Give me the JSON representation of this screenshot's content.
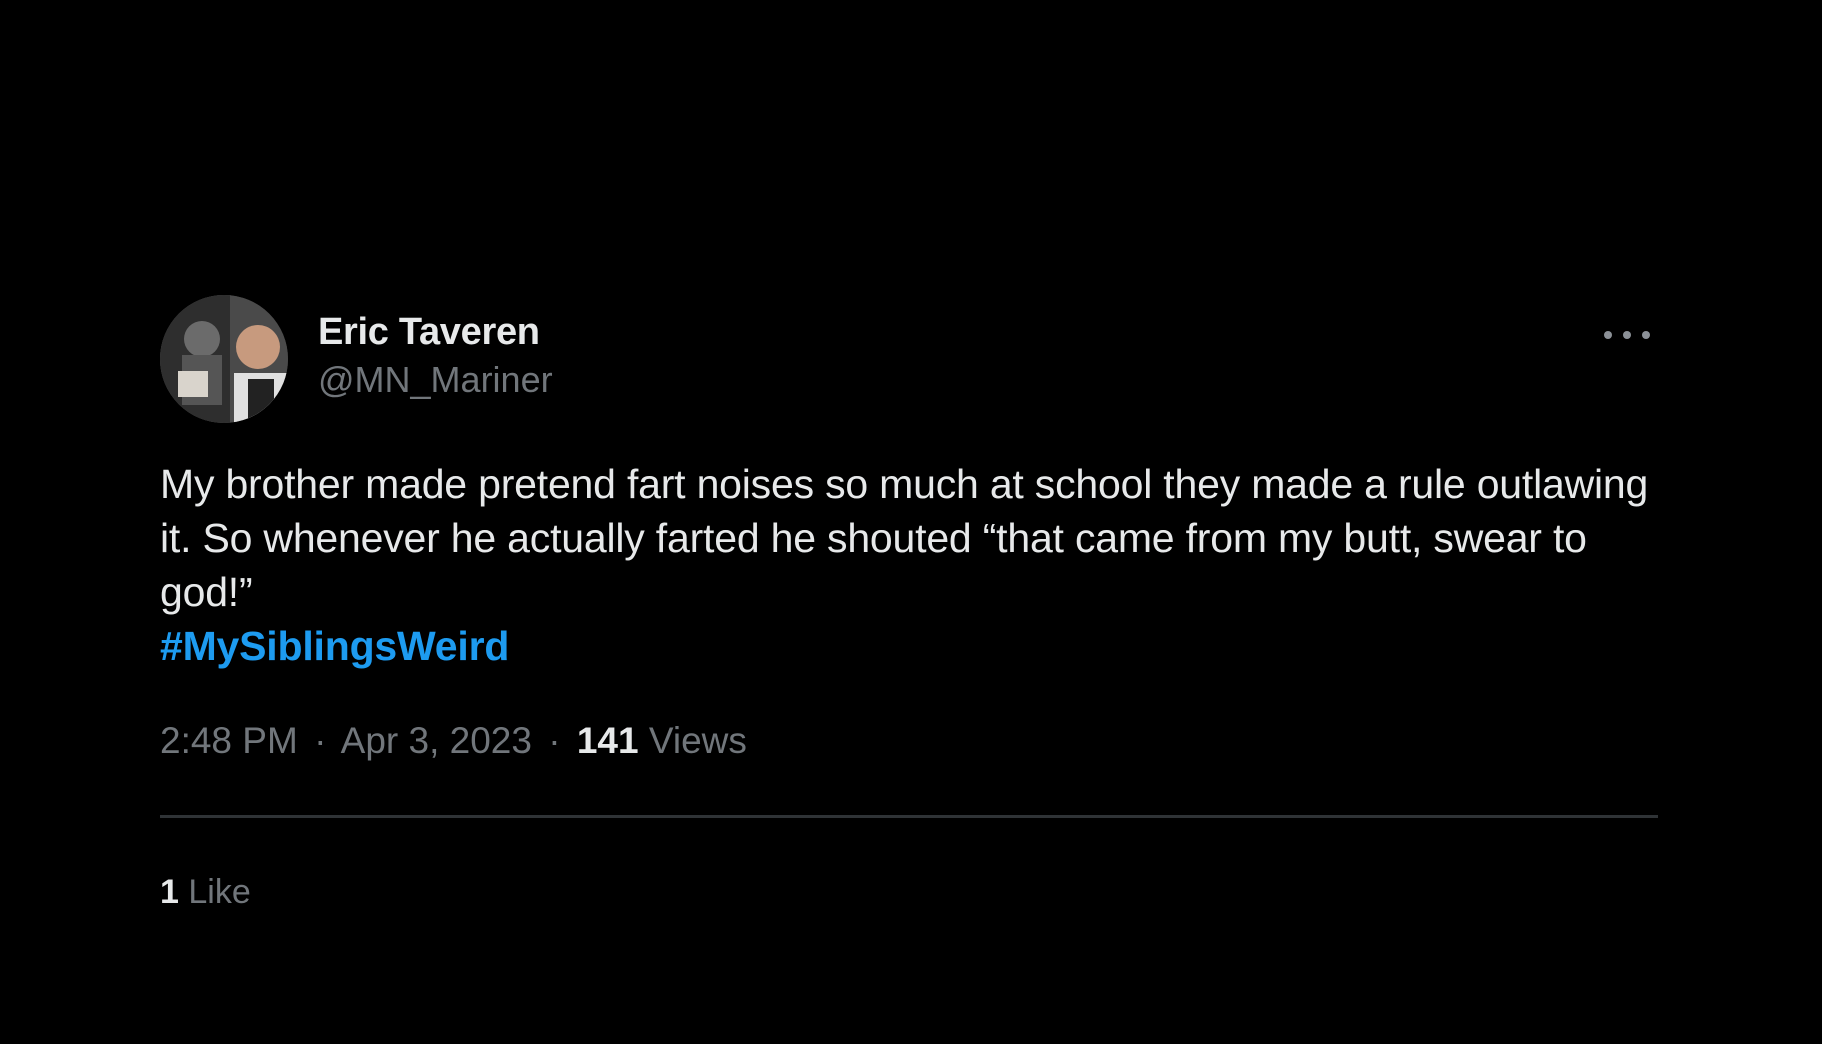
{
  "tweet": {
    "author": {
      "display_name": "Eric Taveren",
      "handle": "@MN_Mariner"
    },
    "text_lines": [
      "My brother made pretend fart noises so much at school they made a rule outlawing it. So whenever he actually farted he shouted “that came from my butt, swear to god!”"
    ],
    "hashtag": "#MySiblingsWeird",
    "time": "2:48 PM",
    "date": "Apr 3, 2023",
    "separator": "·",
    "views_count": "141",
    "views_label": "Views",
    "likes_count": "1",
    "likes_label": "Like"
  },
  "colors": {
    "background": "#000000",
    "primary_text": "#e7e9ea",
    "secondary_text": "#71767b",
    "link": "#1d9bf0",
    "divider": "#2f3336"
  },
  "icons": {
    "more": "more-horizontal-icon"
  }
}
